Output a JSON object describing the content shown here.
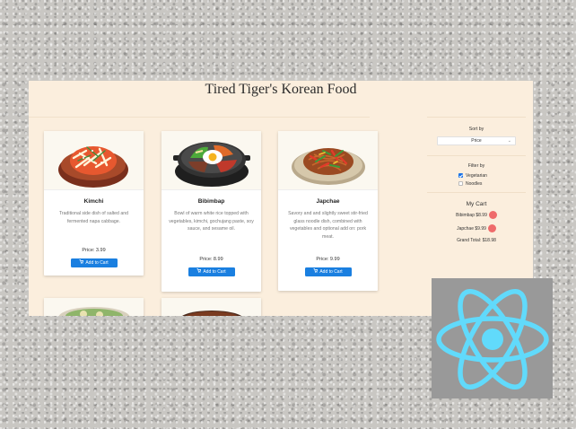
{
  "app": {
    "title": "Tired Tiger's Korean Food"
  },
  "products": [
    {
      "name": "Kimchi",
      "description": "Traditional side dish of salted and fermented napa cabbage.",
      "price": "Price: 3.99",
      "button": "Add to Cart",
      "image_icon": "kimchi-bowl-icon"
    },
    {
      "name": "Bibimbap",
      "description": "Bowl of warm white rice topped with vegetables, kimchi, gochujang paste, soy sauce, and sesame oil.",
      "price": "Price: 8.99",
      "button": "Add to Cart",
      "image_icon": "bibimbap-bowl-icon"
    },
    {
      "name": "Japchae",
      "description": "Savory and and slightly sweet stir-fried glass noodle dish, combined with vegetables and optional add on: pork meat.",
      "price": "Price: 9.99",
      "button": "Add to Cart",
      "image_icon": "japchae-plate-icon"
    }
  ],
  "sidebar": {
    "sort": {
      "label": "Sort by",
      "value": "Price"
    },
    "filter": {
      "label": "Filter by",
      "options": [
        {
          "label": "Vegetarian",
          "checked": true
        },
        {
          "label": "Noodles",
          "checked": false
        }
      ]
    },
    "cart": {
      "title": "My Cart",
      "items": [
        {
          "text": "Bibimbap $8.99"
        },
        {
          "text": "Japchae $9.99"
        }
      ],
      "total": "Grand Total: $18.98"
    }
  },
  "colors": {
    "page_bg": "#fbeedd",
    "button_blue": "#1a7fe0",
    "remove_red": "#ef6b6b",
    "react_cyan": "#61dafb",
    "react_bg": "#999999"
  },
  "icons": [
    "cart-icon",
    "chevron-down-icon",
    "react-logo-icon"
  ]
}
